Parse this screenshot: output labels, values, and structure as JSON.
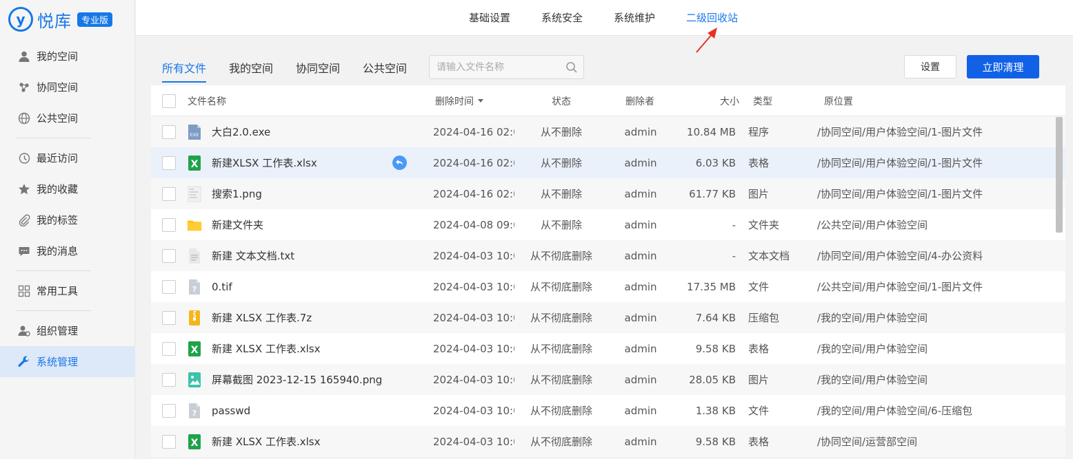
{
  "brand": {
    "name": "悦库",
    "badge": "专业版",
    "mark": "y"
  },
  "sidebar": {
    "groups": [
      [
        {
          "label": "我的空间",
          "icon": "user-icon"
        },
        {
          "label": "协同空间",
          "icon": "collab-icon"
        },
        {
          "label": "公共空间",
          "icon": "globe-icon"
        }
      ],
      [
        {
          "label": "最近访问",
          "icon": "history-icon"
        },
        {
          "label": "我的收藏",
          "icon": "star-icon"
        },
        {
          "label": "我的标签",
          "icon": "paperclip-icon"
        },
        {
          "label": "我的消息",
          "icon": "message-icon"
        }
      ],
      [
        {
          "label": "常用工具",
          "icon": "grid-icon"
        }
      ],
      [
        {
          "label": "组织管理",
          "icon": "org-icon"
        },
        {
          "label": "系统管理",
          "icon": "wrench-icon",
          "active": true
        }
      ]
    ]
  },
  "topnav": {
    "tabs": [
      "基础设置",
      "系统安全",
      "系统维护",
      "二级回收站"
    ],
    "active_index": 3
  },
  "subtabs": {
    "tabs": [
      "所有文件",
      "我的空间",
      "协同空间",
      "公共空间"
    ],
    "active_index": 0
  },
  "search": {
    "placeholder": "请输入文件名称"
  },
  "buttons": {
    "settings": "设置",
    "clear_now": "立即清理"
  },
  "table": {
    "headers": {
      "name": "文件名称",
      "delete_time": "删除时间",
      "status": "状态",
      "deleter": "删除者",
      "size": "大小",
      "type": "类型",
      "location": "原位置"
    },
    "rows": [
      {
        "name": "大白2.0.exe",
        "icon": "exe-icon",
        "time": "2024-04-16 02:0…",
        "status": "从不删除",
        "deleter": "admin",
        "size": "10.84 MB",
        "type": "程序",
        "location": "/协同空间/用户体验空间/1-图片文件"
      },
      {
        "name": "新建XLSX 工作表.xlsx",
        "icon": "excel-icon",
        "time": "2024-04-16 02:0…",
        "status": "从不删除",
        "deleter": "admin",
        "size": "6.03 KB",
        "type": "表格",
        "location": "/协同空间/用户体验空间/1-图片文件",
        "hover": true
      },
      {
        "name": "搜索1.png",
        "icon": "png-thumb-icon",
        "time": "2024-04-16 02:0…",
        "status": "从不删除",
        "deleter": "admin",
        "size": "61.77 KB",
        "type": "图片",
        "location": "/协同空间/用户体验空间/1-图片文件"
      },
      {
        "name": "新建文件夹",
        "icon": "folder-icon",
        "time": "2024-04-08 09:0…",
        "status": "从不删除",
        "deleter": "admin",
        "size": "-",
        "type": "文件夹",
        "location": "/公共空间/用户体验空间"
      },
      {
        "name": "新建 文本文档.txt",
        "icon": "txt-icon",
        "time": "2024-04-03 10:0…",
        "status": "从不彻底删除",
        "deleter": "admin",
        "size": "-",
        "type": "文本文档",
        "location": "/协同空间/用户体验空间/4-办公资料"
      },
      {
        "name": "0.tif",
        "icon": "unknown-file-icon",
        "time": "2024-04-03 10:0…",
        "status": "从不彻底删除",
        "deleter": "admin",
        "size": "17.35 MB",
        "type": "文件",
        "location": "/公共空间/用户体验空间/1-图片文件"
      },
      {
        "name": "新建 XLSX 工作表.7z",
        "icon": "zip-icon",
        "time": "2024-04-03 10:0…",
        "status": "从不彻底删除",
        "deleter": "admin",
        "size": "7.64 KB",
        "type": "压缩包",
        "location": "/我的空间/用户体验空间"
      },
      {
        "name": "新建 XLSX 工作表.xlsx",
        "icon": "excel-icon",
        "time": "2024-04-03 10:0…",
        "status": "从不彻底删除",
        "deleter": "admin",
        "size": "9.58 KB",
        "type": "表格",
        "location": "/我的空间/用户体验空间"
      },
      {
        "name": "屏幕截图 2023-12-15 165940.png",
        "icon": "image-icon",
        "time": "2024-04-03 10:0…",
        "status": "从不彻底删除",
        "deleter": "admin",
        "size": "28.05 KB",
        "type": "图片",
        "location": "/我的空间/用户体验空间"
      },
      {
        "name": "passwd",
        "icon": "unknown-file-icon",
        "time": "2024-04-03 10:0…",
        "status": "从不彻底删除",
        "deleter": "admin",
        "size": "1.38 KB",
        "type": "文件",
        "location": "/我的空间/用户体验空间/6-压缩包"
      },
      {
        "name": "新建 XLSX 工作表.xlsx",
        "icon": "excel-icon",
        "time": "2024-04-03 10:0…",
        "status": "从不彻底删除",
        "deleter": "admin",
        "size": "9.58 KB",
        "type": "表格",
        "location": "/协同空间/运营部空间"
      }
    ]
  },
  "colors": {
    "accent": "#1677e8",
    "primary_button": "#1161e6",
    "annotation_arrow": "#e8321e"
  }
}
